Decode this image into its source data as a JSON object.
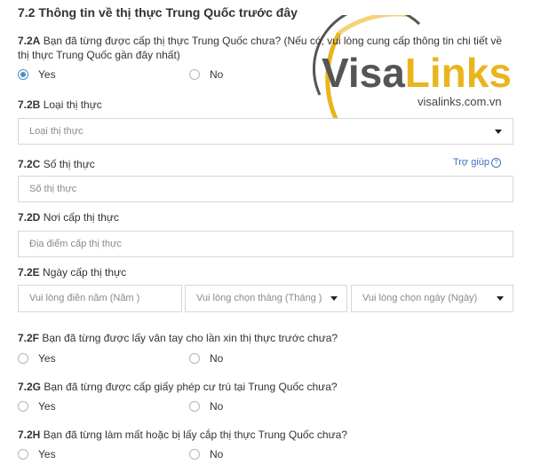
{
  "section_title": "7.2 Thông tin về thị thực Trung Quốc trước đây",
  "watermark": {
    "brand_part1": "Visa",
    "brand_part2": "Links",
    "url": "visalinks.com.vn",
    "color_dark": "#555555",
    "color_accent": "#e9b51e"
  },
  "q_7_2A": {
    "num": "7.2A",
    "text": " Bạn đã từng được cấp thị thực Trung Quốc chưa? (Nếu có, vui lòng cung cấp thông tin chi tiết về thị thực Trung Quốc gần đây nhất)",
    "yes": "Yes",
    "no": "No",
    "selected": "Yes"
  },
  "q_7_2B": {
    "num": "7.2B",
    "text": " Loại thị thực",
    "placeholder": "Loại thị thực"
  },
  "q_7_2C": {
    "num": "7.2C",
    "text": " Số thị thực",
    "placeholder": "Số thị thực",
    "help": "Trợ giúp",
    "help_mark": "?"
  },
  "q_7_2D": {
    "num": "7.2D",
    "text": " Nơi cấp thị thực",
    "placeholder": "Địa điểm cấp thị thực"
  },
  "q_7_2E": {
    "num": "7.2E",
    "text": " Ngày cấp thị thực",
    "year_placeholder": "Vui lòng điền năm (Năm )",
    "month_placeholder": "Vui lòng chọn tháng (Tháng )",
    "day_placeholder": "Vui lòng chọn ngày (Ngày)"
  },
  "q_7_2F": {
    "num": "7.2F",
    "text": " Bạn đã từng được lấy vân tay cho lần xin thị thực trước chưa?",
    "yes": "Yes",
    "no": "No"
  },
  "q_7_2G": {
    "num": "7.2G",
    "text": " Bạn đã từng được cấp giấy phép cư trú tại Trung Quốc chưa?",
    "yes": "Yes",
    "no": "No"
  },
  "q_7_2H": {
    "num": "7.2H",
    "text": " Bạn đã từng làm mất hoặc bị lấy cắp thị thực Trung Quốc chưa?",
    "yes": "Yes",
    "no": "No"
  }
}
